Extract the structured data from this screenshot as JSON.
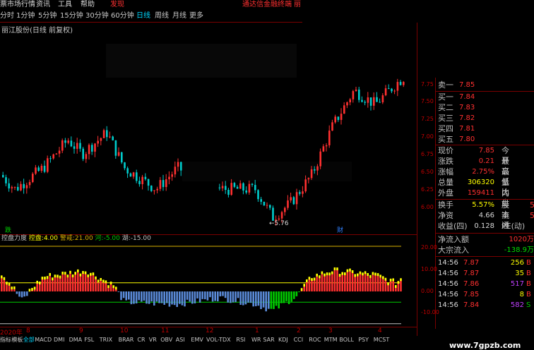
{
  "menu": {
    "items": [
      "票市场行情",
      "资讯",
      "工具",
      "帮助"
    ],
    "alert": "发现",
    "right_link": "通达信金融终端",
    "right_link2": "丽"
  },
  "timeframes": [
    "分时",
    "1分钟",
    "5分钟",
    "15分钟",
    "30分钟",
    "60分钟",
    "日线",
    "周线",
    "月线",
    "更多"
  ],
  "active_timeframe": "日线",
  "stock_title": "丽江股份(日线 前复权)",
  "main_chart": {
    "price_axis": [
      "7.75",
      "7.50",
      "7.25",
      "7.00",
      "6.75",
      "6.50",
      "6.25",
      "6.00"
    ],
    "low_label": "←5.76",
    "marker_left": "跌",
    "marker_right": "财"
  },
  "indicator": {
    "name": "控盘力度",
    "items": [
      {
        "label": "控盘:",
        "value": "4.00",
        "color": "#ffff00"
      },
      {
        "label": "警戒:",
        "value": "21.00",
        "color": "#d8b000"
      },
      {
        "label": "河:",
        "value": "-5.00",
        "color": "#00cc00"
      },
      {
        "label": "湖:",
        "value": "-15.00",
        "color": "#c0c0c0"
      }
    ],
    "axis": [
      "20.00",
      "10.00",
      "0.00",
      "-10.00"
    ]
  },
  "quote": {
    "sell": [
      {
        "label": "卖一",
        "price": "7.85"
      }
    ],
    "buy": [
      {
        "label": "买一",
        "price": "7.84"
      },
      {
        "label": "买二",
        "price": "7.83"
      },
      {
        "label": "买三",
        "price": "7.82"
      },
      {
        "label": "买四",
        "price": "7.81"
      },
      {
        "label": "买五",
        "price": "7.80"
      }
    ],
    "stats": [
      {
        "label": "现价",
        "value": "7.85",
        "label2": "今开",
        "color": "#ff3030"
      },
      {
        "label": "涨跌",
        "value": "0.21",
        "label2": "最高",
        "color": "#ff3030"
      },
      {
        "label": "涨幅",
        "value": "2.75%",
        "label2": "最低",
        "color": "#ff3030"
      },
      {
        "label": "总量",
        "value": "306320",
        "label2": "量比",
        "color": "#ffff00"
      },
      {
        "label": "外盘",
        "value": "159411",
        "label2": "内盘",
        "color": "#ff3030"
      }
    ],
    "stats2": [
      {
        "label": "换手",
        "value": "5.57%",
        "label2": "股本",
        "tail": "5",
        "color": "#ffff00"
      },
      {
        "label": "净资",
        "value": "4.66",
        "label2": "流通",
        "tail": "5",
        "color": "#d8d8d8"
      },
      {
        "label": "收益(四)",
        "value": "0.128",
        "label2": "PE(动)",
        "tail": "",
        "color": "#d8d8d8"
      }
    ],
    "flow": [
      {
        "label": "净流入额",
        "value": "1020万",
        "color": "#ff3030"
      },
      {
        "label": "大宗流入",
        "value": "-138.9万",
        "color": "#00dd00"
      }
    ],
    "trades": [
      {
        "time": "14:56",
        "price": "7.87",
        "vol": "256",
        "vcolor": "#ffff00",
        "dir": "B"
      },
      {
        "time": "14:56",
        "price": "7.87",
        "vol": "35",
        "vcolor": "#ffff00",
        "dir": "B"
      },
      {
        "time": "14:56",
        "price": "7.86",
        "vol": "517",
        "vcolor": "#c040ff",
        "dir": "B"
      },
      {
        "time": "14:56",
        "price": "7.85",
        "vol": "8",
        "vcolor": "#ffff00",
        "dir": "B"
      },
      {
        "time": "14:56",
        "price": "7.84",
        "vol": "582",
        "vcolor": "#c040ff",
        "dir": "S"
      }
    ]
  },
  "date_axis": [
    "2020年",
    "8",
    "9",
    "10",
    "11",
    "12",
    "1",
    "2",
    "3",
    "4"
  ],
  "bottom_tabs": [
    "指标",
    "模板",
    "全部",
    "MACD",
    "DMI",
    "DMA",
    "FSL",
    "TRIX",
    "BRAR",
    "CR",
    "VR",
    "OBV",
    "ASI",
    "EMV",
    "VOL-TDX",
    "RSI",
    "WR",
    "SAR",
    "KDJ",
    "CCI",
    "ROC",
    "MTM",
    "BOLL",
    "PSY",
    "MCST"
  ],
  "active_tab": "全部",
  "watermark": "www.7gpzb.com",
  "colors": {
    "up": "#ff3030",
    "down": "#00cccc",
    "bg": "#000000",
    "grid": "#7a0000"
  }
}
